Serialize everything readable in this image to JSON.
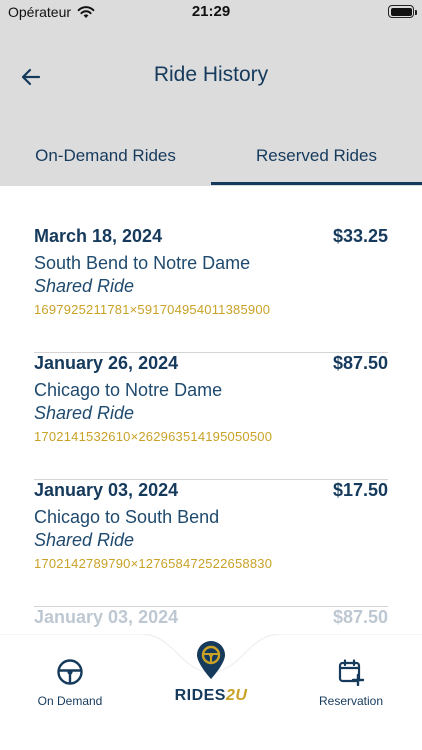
{
  "status_bar": {
    "carrier": "Opérateur",
    "time": "21:29"
  },
  "header": {
    "title": "Ride History"
  },
  "tabs": [
    {
      "label": "On-Demand Rides",
      "active": false
    },
    {
      "label": "Reserved Rides",
      "active": true
    }
  ],
  "rides": [
    {
      "date": "March 18, 2024",
      "price": "$33.25",
      "route": "South Bend to Notre Dame",
      "type": "Shared Ride",
      "id": "1697925211781×591704954011385900"
    },
    {
      "date": "January 26, 2024",
      "price": "$87.50",
      "route": "Chicago to Notre Dame",
      "type": "Shared Ride",
      "id": "1702141532610×262963514195050500"
    },
    {
      "date": "January 03, 2024",
      "price": "$17.50",
      "route": "Chicago to South Bend",
      "type": "Shared Ride",
      "id": "1702142789790×127658472522658830"
    },
    {
      "date": "January 03, 2024",
      "price": "$87.50"
    }
  ],
  "bottom_nav": {
    "left_label": "On Demand",
    "brand_main": "RIDES",
    "brand_accent": "2U",
    "right_label": "Reservation"
  },
  "colors": {
    "navy": "#163a5c",
    "gold": "#c9a227",
    "header_bg": "#dcdcdc"
  },
  "icons": {
    "back": "arrow-left-icon",
    "left_nav": "steering-wheel-icon",
    "center_nav": "location-pin-wheel-icon",
    "right_nav": "calendar-add-icon"
  }
}
